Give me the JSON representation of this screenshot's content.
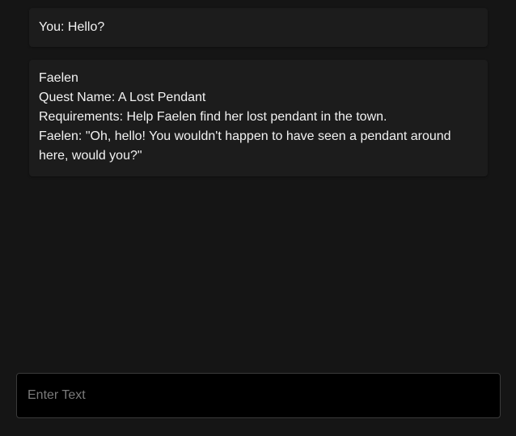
{
  "chat": {
    "messages": [
      {
        "speaker": "user",
        "lines": [
          "You: Hello?"
        ]
      },
      {
        "speaker": "npc",
        "lines": [
          "Faelen",
          "Quest Name: A Lost Pendant",
          "Requirements: Help Faelen find her lost pendant in the town.",
          "Faelen: \"Oh, hello! You wouldn't happen to have seen a pendant around here, would you?\""
        ]
      }
    ]
  },
  "input": {
    "placeholder": "Enter Text",
    "value": ""
  },
  "colors": {
    "background": "#151515",
    "message_bg": "#1c1c1c",
    "input_bg": "#000000",
    "text": "#f2f2f2"
  }
}
